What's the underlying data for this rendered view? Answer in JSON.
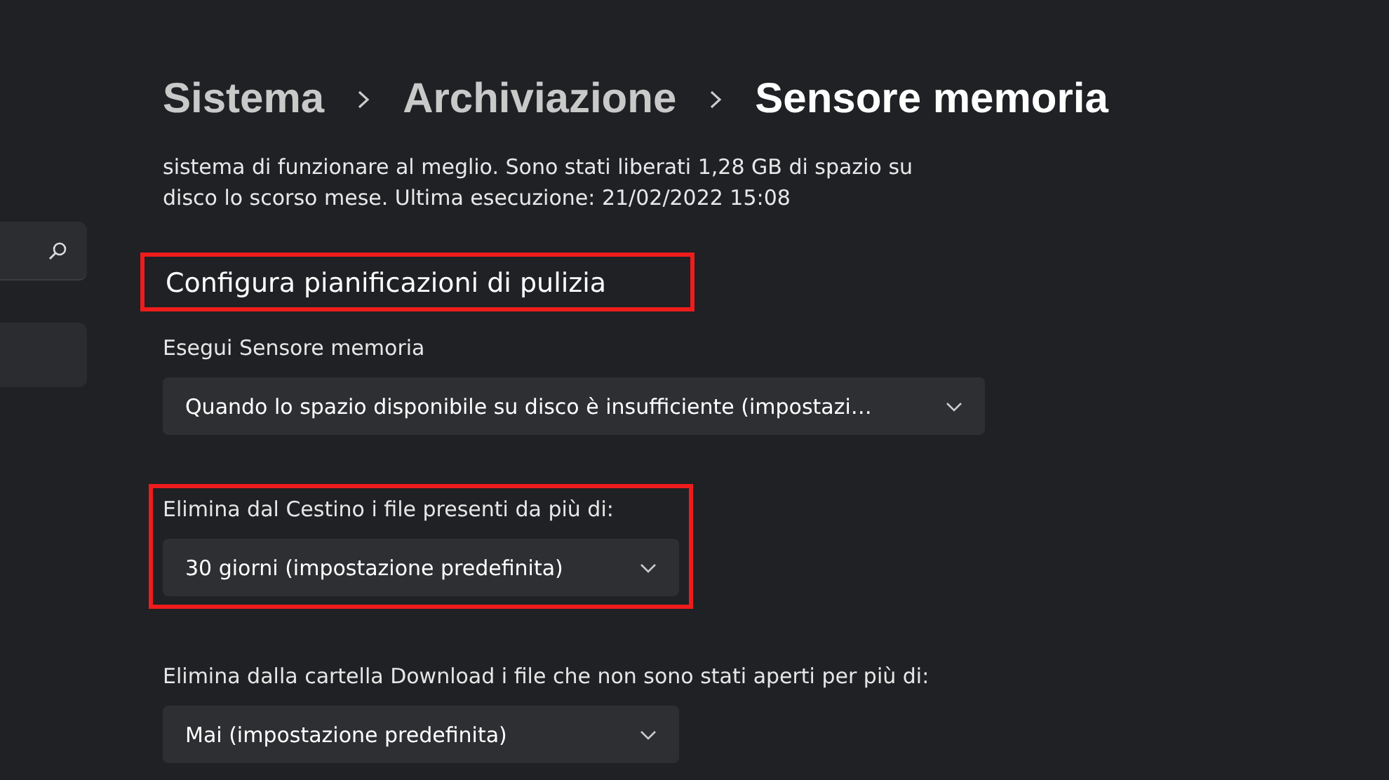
{
  "sidebar": {
    "items": [
      {
        "selected": false
      }
    ]
  },
  "breadcrumb": [
    "Sistema",
    "Archiviazione",
    "Sensore memoria"
  ],
  "description": "sistema di funzionare al meglio. Sono stati liberati 1,28 GB di spazio su disco lo scorso mese. Ultima esecuzione: 21/02/2022 15:08",
  "section": {
    "title": "Configura pianificazioni di pulizia",
    "highlighted": true
  },
  "settings": [
    {
      "label": "Esegui Sensore memoria",
      "value": "Quando lo spazio disponibile su disco è insufficiente (impostazi…",
      "wide": true,
      "highlighted": false
    },
    {
      "label": "Elimina dal Cestino i file presenti da più di:",
      "value": "30 giorni (impostazione predefinita)",
      "wide": false,
      "highlighted": true
    },
    {
      "label": "Elimina dalla cartella Download i file che non sono stati aperti per più di:",
      "value": "Mai (impostazione predefinita)",
      "wide": false,
      "highlighted": false
    }
  ]
}
